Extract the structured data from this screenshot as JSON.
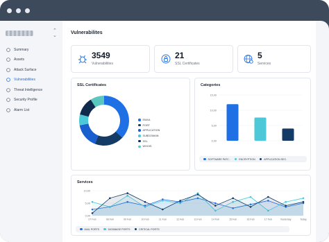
{
  "window": {
    "controls": [
      "dot",
      "dot",
      "dot"
    ]
  },
  "sidebar": {
    "items": [
      {
        "label": "Summary",
        "icon": "summary-icon"
      },
      {
        "label": "Assets",
        "icon": "assets-icon"
      },
      {
        "label": "Attack Surface",
        "icon": "attack-surface-icon"
      },
      {
        "label": "Vulnerabilities",
        "icon": "vulnerabilities-icon",
        "active": true
      },
      {
        "label": "Threat Intelligence",
        "icon": "threat-icon"
      },
      {
        "label": "Security Profile",
        "icon": "security-profile-icon"
      },
      {
        "label": "Alarm List",
        "icon": "alarm-icon"
      }
    ],
    "active_color": "#1f6fe5"
  },
  "page": {
    "title": "Vulnerabilites"
  },
  "stats": [
    {
      "value": "3549",
      "label": "Vulnerabilities",
      "icon": "bug-icon"
    },
    {
      "value": "21",
      "label": "SSL Certificates",
      "icon": "certificate-icon"
    },
    {
      "value": "5",
      "label": "Services",
      "icon": "services-globe-icon"
    }
  ],
  "ssl": {
    "title": "SSL Certificates",
    "legend": [
      {
        "label": "EMAIL",
        "color": "#1f6fe5"
      },
      {
        "label": "PORT",
        "color": "#143a66"
      },
      {
        "label": "APPLICATION",
        "color": "#1a5fd0"
      },
      {
        "label": "SUBDOMAIN",
        "color": "#4cc8d8"
      },
      {
        "label": "SSL",
        "color": "#0f2a4d"
      },
      {
        "label": "WHOIS",
        "color": "#59c7c0"
      }
    ]
  },
  "categories": {
    "title": "Categories",
    "legend": [
      {
        "label": "SOFTWARE PATC..",
        "color": "#1f6fe5"
      },
      {
        "label": "ENCRYPTION",
        "color": "#4cc8d8"
      },
      {
        "label": "APPLICATION SEC.",
        "color": "#143a66"
      }
    ]
  },
  "services": {
    "title": "Services",
    "legend": [
      {
        "label": "MAIL PORTS",
        "color": "#1f6fe5"
      },
      {
        "label": "DATABASE PORTS",
        "color": "#4cc8d8"
      },
      {
        "label": "CRITICAL PORTS",
        "color": "#143a66"
      }
    ]
  },
  "chart_data": [
    {
      "type": "pie",
      "title": "SSL Certificates",
      "categories": [
        "EMAIL",
        "PORT",
        "APPLICATION",
        "SUBDOMAIN",
        "SSL",
        "WHOIS"
      ],
      "values": [
        37,
        19,
        16,
        7,
        12,
        9
      ],
      "colors": [
        "#1f6fe5",
        "#143a66",
        "#1a5fd0",
        "#4cc8d8",
        "#0f2a4d",
        "#59c7c0"
      ],
      "donut": true
    },
    {
      "type": "bar",
      "title": "Categories",
      "categories": [
        "SOFTWARE PATC..",
        "ENCRYPTION",
        "APPLICATION SEC."
      ],
      "values": [
        12.0,
        7.6,
        4.0
      ],
      "colors": [
        "#1f6fe5",
        "#4cc8d8",
        "#143a66"
      ],
      "ylim": [
        0,
        15
      ],
      "yticks": [
        "0,00",
        "5,00",
        "10,00",
        "15,00"
      ],
      "ytick_values": [
        0,
        5,
        10,
        15
      ]
    },
    {
      "type": "area",
      "title": "Services",
      "x": [
        "07 Feb",
        "08 Feb",
        "09 Feb",
        "10 Feb",
        "11 Feb",
        "12 Feb",
        "13 Feb",
        "14 Feb",
        "15 Feb",
        "16 Feb",
        "17 Feb",
        "Yesterday",
        "Today"
      ],
      "ylim": [
        0,
        10
      ],
      "yticks": [
        "0,00",
        "5,00",
        "10,00"
      ],
      "ytick_values": [
        0,
        5,
        10
      ],
      "series": [
        {
          "name": "MAIL PORTS",
          "color": "#1f6fe5",
          "values": [
            2.5,
            3.5,
            5.5,
            4.0,
            6.5,
            5.5,
            7.0,
            5.0,
            3.0,
            4.5,
            6.0,
            3.5,
            5.0
          ]
        },
        {
          "name": "DATABASE PORTS",
          "color": "#4cc8d8",
          "values": [
            5.5,
            3.5,
            8.0,
            3.5,
            6.0,
            5.0,
            9.0,
            2.0,
            5.5,
            7.5,
            2.0,
            5.5,
            7.0
          ]
        },
        {
          "name": "CRITICAL PORTS",
          "color": "#143a66",
          "values": [
            1.0,
            7.0,
            9.0,
            5.5,
            2.5,
            6.0,
            8.5,
            4.0,
            7.0,
            3.5,
            7.5,
            4.0,
            5.5
          ]
        }
      ]
    }
  ]
}
